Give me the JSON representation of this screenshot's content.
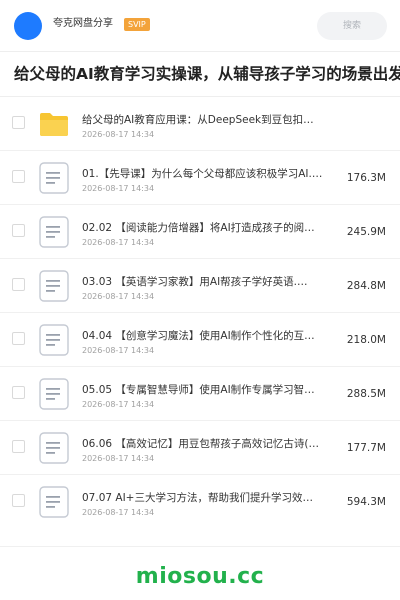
{
  "header": {
    "username": "夸克网盘分享",
    "badge": "SVIP",
    "search_placeholder": "搜索"
  },
  "share": {
    "title": "给父母的AI教育学习实操课，从辅导孩子学习的场景出发，"
  },
  "files": [
    {
      "type": "folder-icon",
      "name": "给父母的AI教育应用课：从DeepSeek到豆包扣…",
      "date": "2026-08-17 14:34",
      "size": ""
    },
    {
      "type": "document-icon",
      "name": "01.【先导课】为什么每个父母都应该积极学习AI.…",
      "date": "2026-08-17 14:34",
      "size": "176.3M"
    },
    {
      "type": "document-icon",
      "name": "02.02 【阅读能力倍增器】将AI打造成孩子的阅…",
      "date": "2026-08-17 14:34",
      "size": "245.9M"
    },
    {
      "type": "document-icon",
      "name": "03.03 【英语学习家教】用AI帮孩子学好英语.…",
      "date": "2026-08-17 14:34",
      "size": "284.8M"
    },
    {
      "type": "document-icon",
      "name": "04.04 【创意学习魔法】使用AI制作个性化的互…",
      "date": "2026-08-17 14:34",
      "size": "218.0M"
    },
    {
      "type": "document-icon",
      "name": "05.05 【专属智慧导师】使用AI制作专属学习智…",
      "date": "2026-08-17 14:34",
      "size": "288.5M"
    },
    {
      "type": "document-icon",
      "name": "06.06 【高效记忆】用豆包帮孩子高效记忆古诗(…",
      "date": "2026-08-17 14:34",
      "size": "177.7M"
    },
    {
      "type": "document-icon",
      "name": "07.07 AI+三大学习方法，帮助我们提升学习效…",
      "date": "2026-08-17 14:34",
      "size": "594.3M"
    }
  ],
  "watermark": "miosou.cc",
  "colors": {
    "avatar": "#1e7bff",
    "badge": "#f3a33a",
    "folder": "#f7c531",
    "watermark": "#22b14c"
  }
}
